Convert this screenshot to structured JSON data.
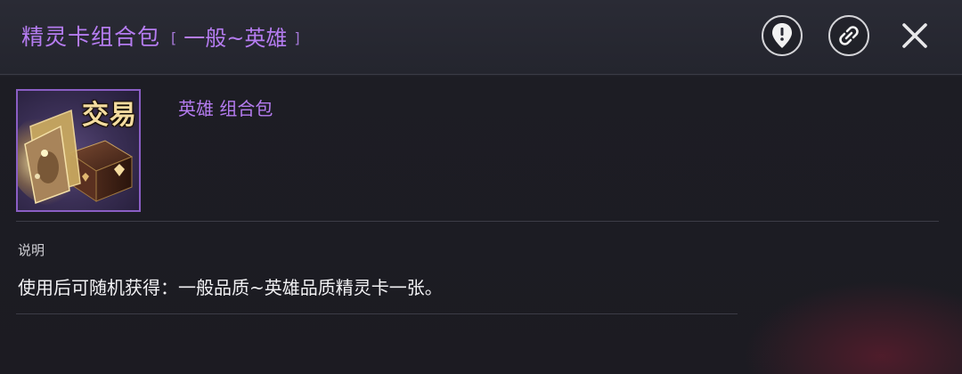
{
  "header": {
    "title": "精灵卡组合包",
    "bracket_open": "[",
    "grade": "一般~英雄",
    "bracket_close": "]",
    "report_icon": "location-alert-icon",
    "link_icon": "chain-link-icon",
    "close_icon": "close-icon"
  },
  "item": {
    "trade_tag": "交易",
    "type_label": "英雄 组合包",
    "icon": "card-pack-box-icon"
  },
  "description": {
    "label": "说明",
    "text": "使用后可随机获得：一般品质~英雄品质精灵卡一张。"
  },
  "colors": {
    "accent_purple": "#b57cf0",
    "frame_purple": "#8a5ec4"
  }
}
